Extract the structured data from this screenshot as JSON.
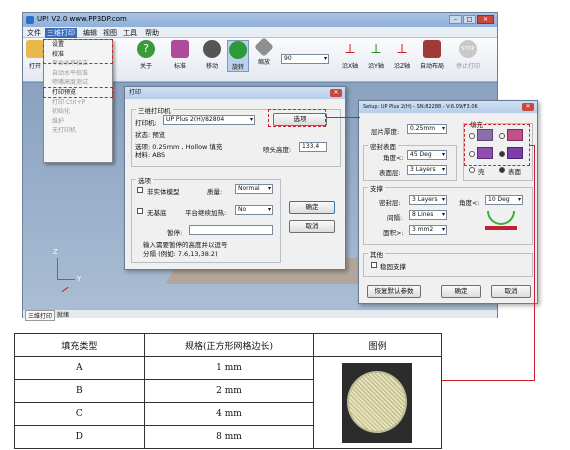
{
  "app": {
    "title": "UP! V2.0 www.PP3DP.com",
    "menu": [
      "文件",
      "三维打印",
      "编辑",
      "视图",
      "工具",
      "帮助"
    ],
    "toolbar": [
      "打开",
      "关于",
      "标准",
      "移动",
      "旋转",
      "缩放",
      "沿X轴",
      "沿Y轴",
      "沿Z轴",
      "自动布局",
      "停止打印"
    ],
    "zoom_value": "90",
    "status_tab": "三维打印",
    "status_text": "就绪",
    "axis_labels": [
      "Z",
      "Y"
    ]
  },
  "dropdown": {
    "items": [
      {
        "label": "设置",
        "enabled": true
      },
      {
        "label": "校准",
        "enabled": true
      },
      {
        "label": "平台水平校正",
        "enabled": false
      },
      {
        "label": "自动水平校准",
        "enabled": false
      },
      {
        "label": "喷嘴高度测试",
        "enabled": false
      },
      {
        "label": "打印预览",
        "enabled": true
      },
      {
        "label": "打印  Ctrl+P",
        "enabled": false
      },
      {
        "label": "初始化",
        "enabled": false
      },
      {
        "label": "维护",
        "enabled": false
      },
      {
        "label": "无打印机",
        "enabled": false
      }
    ]
  },
  "print_dialog": {
    "title": "打印",
    "group_printer": "三维打印机",
    "printer_label": "打印机:",
    "printer_value": "UP Plus 2(H)/82804",
    "options_button": "选项",
    "status_line": "状态: 预览",
    "options_line": "选项: 0.25mm , Hollow 填充",
    "material_line": "材料: ABS",
    "nozzle_label": "喷头高度:",
    "nozzle_value": "133.4",
    "group_options": "选项",
    "cb_non_solid": "非实体模型",
    "quality_label": "质量:",
    "quality_value": "Normal",
    "cb_no_base": "无基底",
    "platform_heat_label": "平台继续加热:",
    "platform_heat_value": "No",
    "pause_label": "暂停:",
    "pause_hint_1": "输入需要暂停的高度并以逗号",
    "pause_hint_2": "分隔 (例如: 7.6,13,38.2)",
    "ok_button": "确定",
    "cancel_button": "取消"
  },
  "setup_dialog": {
    "title": "Setup: UP Plus 2(H) - SN:82288 - V:6.09/F3.06",
    "layer_label": "层片厚度:",
    "layer_value": "0.25mm",
    "fill_group": "填充",
    "seal_group": "密封表面",
    "angle_label": "角度<:",
    "angle_value": "45 Deg",
    "surface_label": "表面层:",
    "surface_value": "3 Layers",
    "radio_shell": "壳",
    "radio_surface": "表面",
    "support_group": "支撑",
    "density_label": "密封层:",
    "density_value": "3 Layers",
    "support_angle_label": "角度<:",
    "support_angle_value": "10 Deg",
    "spacing_label": "间隔:",
    "spacing_value": "8 Lines",
    "area_label": "面积>:",
    "area_value": "3 mm2",
    "other_group": "其他",
    "stable_support": "稳固支撑",
    "restore_button": "恢复默认参数",
    "ok_button": "确定",
    "cancel_button": "取消"
  },
  "table": {
    "headers": [
      "填充类型",
      "规格(正方形网格边长)",
      "图例"
    ],
    "rows": [
      {
        "type": "A",
        "spec": "1 mm"
      },
      {
        "type": "B",
        "spec": "2 mm"
      },
      {
        "type": "C",
        "spec": "4 mm"
      },
      {
        "type": "D",
        "spec": "8 mm"
      }
    ]
  },
  "colors": {
    "accent_red": "#d0202a",
    "workspace_blue": "#9db3cd",
    "dialog_bg": "#f0f0f0"
  }
}
